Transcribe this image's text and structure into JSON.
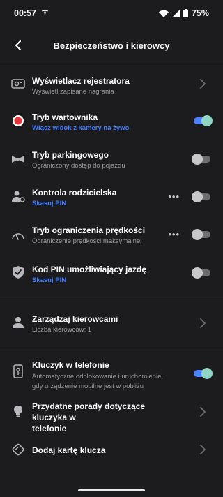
{
  "status_bar": {
    "time": "00:57",
    "battery": "75%",
    "icons": [
      "tesla-logo-icon",
      "wifi-icon",
      "signal-icon",
      "battery-icon"
    ]
  },
  "header": {
    "title": "Bezpieczeństwo i kierowcy",
    "back_icon": "back-arrow-icon"
  },
  "settings": {
    "dashcam": {
      "title": "Wyświetlacz rejestratora",
      "subtitle": "Wyświetl zapisane nagrania",
      "icon": "dashcam-icon"
    },
    "sentry": {
      "title": "Tryb wartownika",
      "subtitle": "Włącz widok z kamery na żywo",
      "icon": "sentry-icon",
      "enabled": true
    },
    "valet": {
      "title": "Tryb parkingowego",
      "subtitle": "Ograniczony dostęp do pojazdu",
      "icon": "bowtie-icon",
      "enabled": false
    },
    "parental": {
      "title": "Kontrola rodzicielska",
      "subtitle": "Skasuj PIN",
      "icon": "parental-icon",
      "enabled": false
    },
    "speed_limit": {
      "title": "Tryb ograniczenia prędkości",
      "subtitle": "Ograniczenie prędkości maksymalnej",
      "icon": "speedometer-icon",
      "enabled": false
    },
    "pin_drive": {
      "title": "Kod PIN umożliwiający jazdę",
      "subtitle": "Skasuj PIN",
      "icon": "shield-check-icon",
      "enabled": false
    },
    "drivers": {
      "title": "Zarządzaj kierowcami",
      "subtitle": "Liczba kierowców: 1",
      "icon": "person-icon"
    },
    "phone_key": {
      "title": "Kluczyk w telefonie",
      "subtitle_line1": "Automatyczne odblokowanie i uruchomienie,",
      "subtitle_line2": "gdy urządzenie mobilne jest w pobliżu",
      "icon": "phone-key-icon",
      "enabled": true
    },
    "tips": {
      "title_line1": "Przydatne porady dotyczące kluczyka w",
      "title_line2": "telefonie",
      "icon": "lightbulb-icon"
    },
    "key_card": {
      "title": "Dodaj kartę klucza",
      "icon": "key-card-icon"
    }
  },
  "colors": {
    "background": "#1c1c1e",
    "link": "#3f7cff",
    "toggle_on_track": "#4d82ff",
    "toggle_on_knob": "#8fd6c4",
    "sentry_red": "#e3343b"
  }
}
